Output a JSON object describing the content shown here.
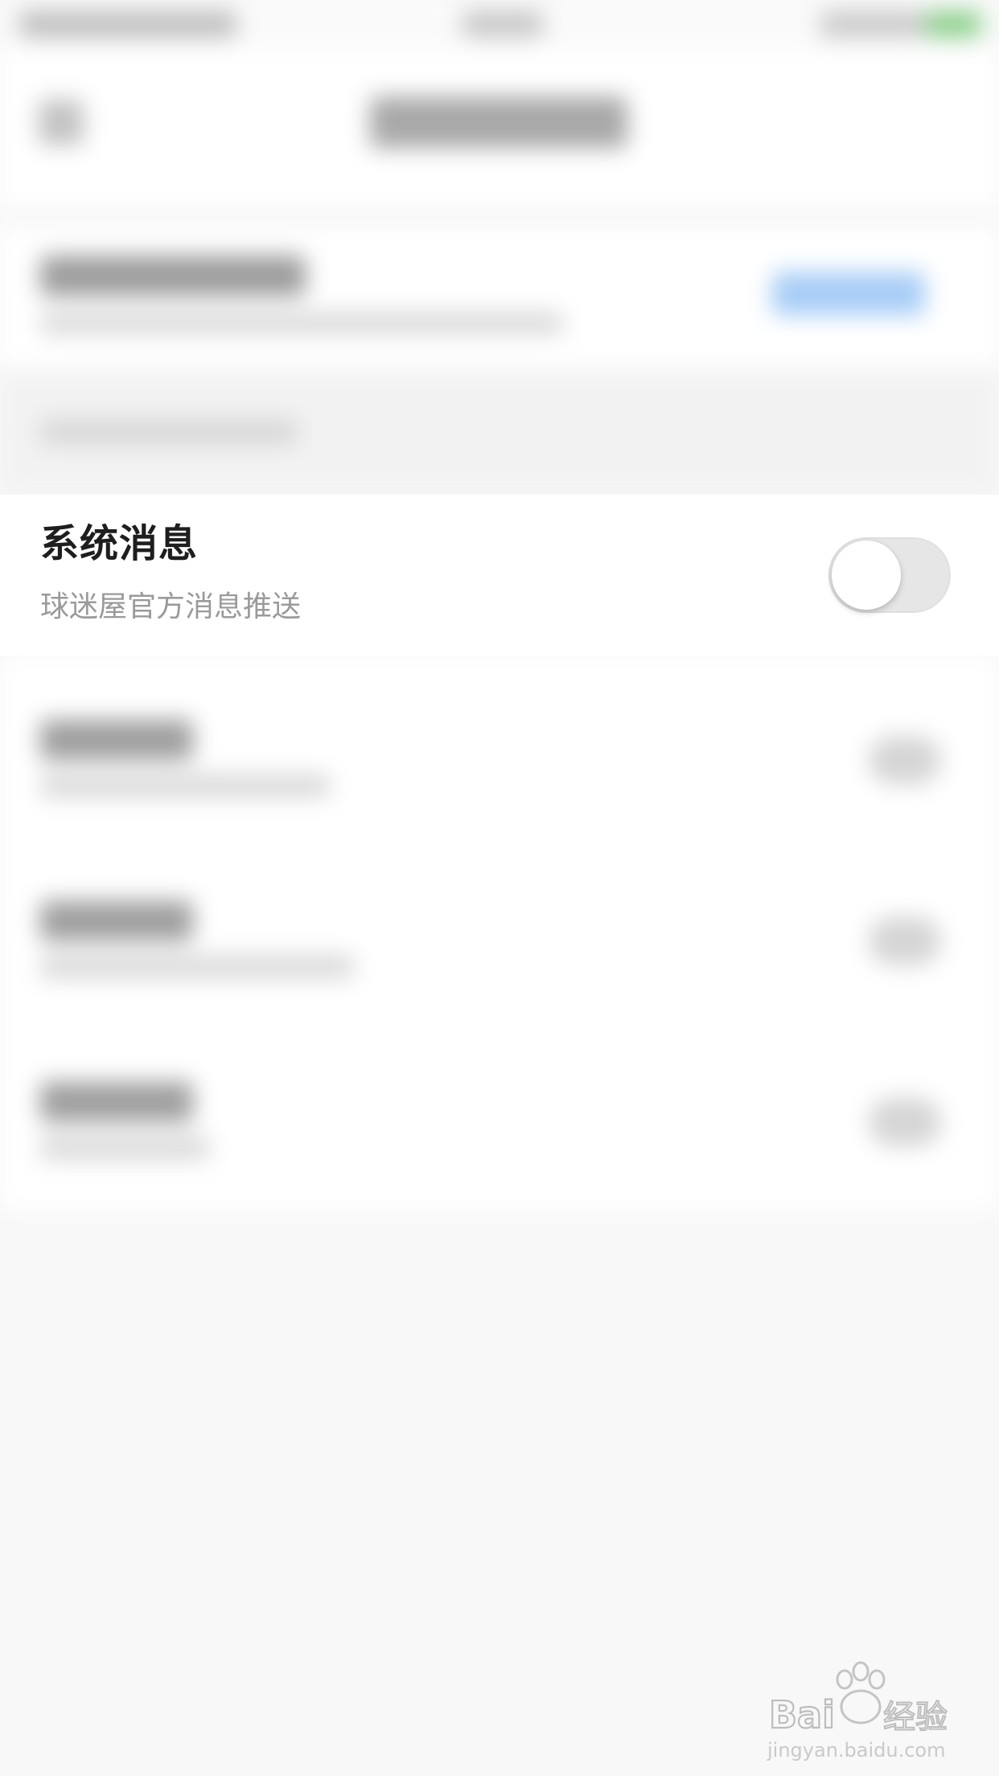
{
  "system_message": {
    "title": "系统消息",
    "subtitle": "球迷屋官方消息推送",
    "toggle_on": false
  },
  "watermark": {
    "brand": "Baidu经验",
    "url": "jingyan.baidu.com"
  }
}
